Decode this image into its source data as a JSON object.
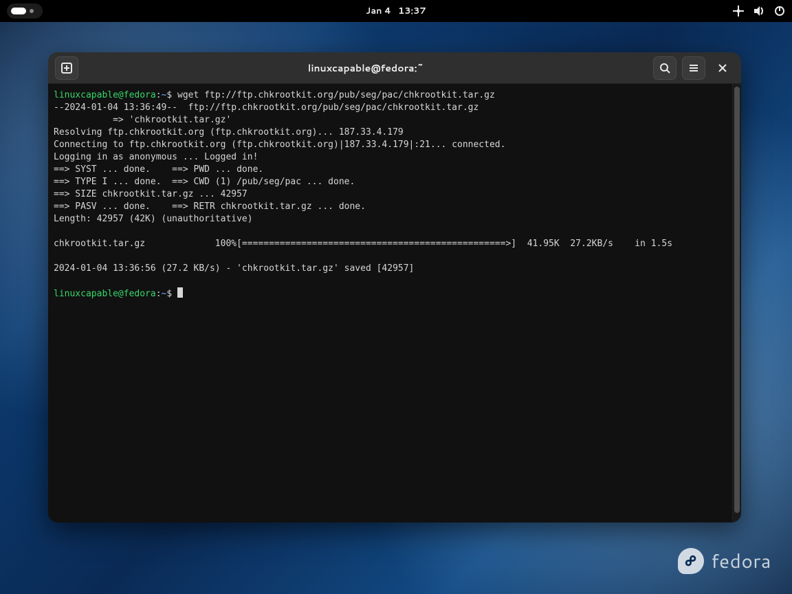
{
  "topbar": {
    "date": "Jan 4",
    "time": "13:37"
  },
  "window": {
    "title": "linuxcapable@fedora:~"
  },
  "prompt": {
    "user_host": "linuxcapable@fedora",
    "colon": ":",
    "path": "~",
    "ps": "$"
  },
  "terminal": {
    "command": "wget ftp://ftp.chkrootkit.org/pub/seg/pac/chkrootkit.tar.gz",
    "lines": {
      "l1": "--2024-01-04 13:36:49--  ftp://ftp.chkrootkit.org/pub/seg/pac/chkrootkit.tar.gz",
      "l2": "           => 'chkrootkit.tar.gz'",
      "l3": "Resolving ftp.chkrootkit.org (ftp.chkrootkit.org)... 187.33.4.179",
      "l4": "Connecting to ftp.chkrootkit.org (ftp.chkrootkit.org)|187.33.4.179|:21... connected.",
      "l5": "Logging in as anonymous ... Logged in!",
      "l6": "==> SYST ... done.    ==> PWD ... done.",
      "l7": "==> TYPE I ... done.  ==> CWD (1) /pub/seg/pac ... done.",
      "l8": "==> SIZE chkrootkit.tar.gz ... 42957",
      "l9": "==> PASV ... done.    ==> RETR chkrootkit.tar.gz ... done.",
      "l10": "Length: 42957 (42K) (unauthoritative)",
      "blank1": "",
      "progress": "chkrootkit.tar.gz             100%[=================================================>]  41.95K  27.2KB/s    in 1.5s",
      "blank2": "",
      "saved": "2024-01-04 13:36:56 (27.2 KB/s) - 'chkrootkit.tar.gz' saved [42957]",
      "blank3": ""
    }
  },
  "watermark": {
    "text": "fedora"
  }
}
